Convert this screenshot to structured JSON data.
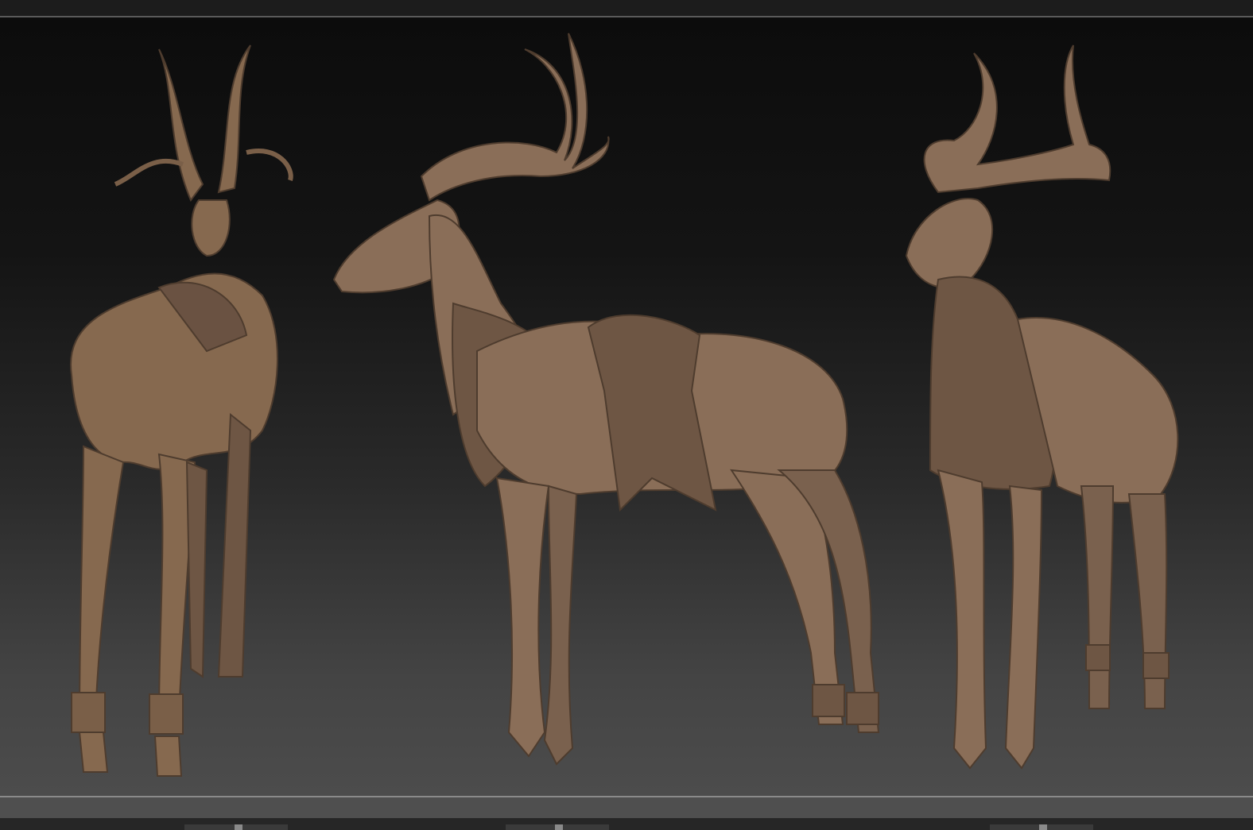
{
  "colors": {
    "sculpt": "#8a6e58",
    "sculpt_shadow": "#5e4a3b",
    "background_top": "#0c0c0c",
    "background_bottom": "#4c4c4c"
  }
}
